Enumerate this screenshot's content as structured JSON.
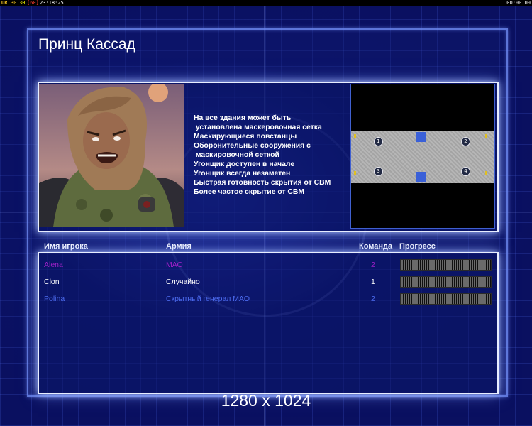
{
  "overlay": {
    "fps_label": "UR",
    "fps_a": "30",
    "fps_b": "30",
    "fps_c": "[60]",
    "clock": "23:18:25",
    "timer": "00:00:00"
  },
  "general": {
    "name": "Принц Кассад",
    "features": [
      "На все здания может быть",
      " установлена маскеровочная сетка",
      "Маскирующиеся повстанцы",
      "Оборонительные сооружения с",
      " маскировочной сеткой",
      "Угонщик доступен в начале",
      "Угонщик всегда незаметен",
      "Быстрая готовность скрытия от СВМ",
      "Более частое скрытие от СВМ"
    ]
  },
  "map": {
    "start_positions": [
      "1",
      "2",
      "3",
      "4"
    ]
  },
  "table": {
    "headers": {
      "player": "Имя игрока",
      "army": "Армия",
      "team": "Команда",
      "progress": "Прогресс"
    },
    "rows": [
      {
        "name": "Alena",
        "army": "МАО",
        "team": "2",
        "color": "#a020c8",
        "progress": 1.0
      },
      {
        "name": "Clon",
        "army": "Случайно",
        "team": "1",
        "color": "#ffffff",
        "progress": 1.0
      },
      {
        "name": "Polina",
        "army": "Скрытный генерал МАО",
        "team": "2",
        "color": "#4d6cf0",
        "progress": 1.0
      }
    ]
  },
  "resolution_label": "1280 x 1024",
  "colors": {
    "panel_border": "#e8eeff",
    "background": "#0a1060",
    "map_notch": "#3a60d8"
  }
}
